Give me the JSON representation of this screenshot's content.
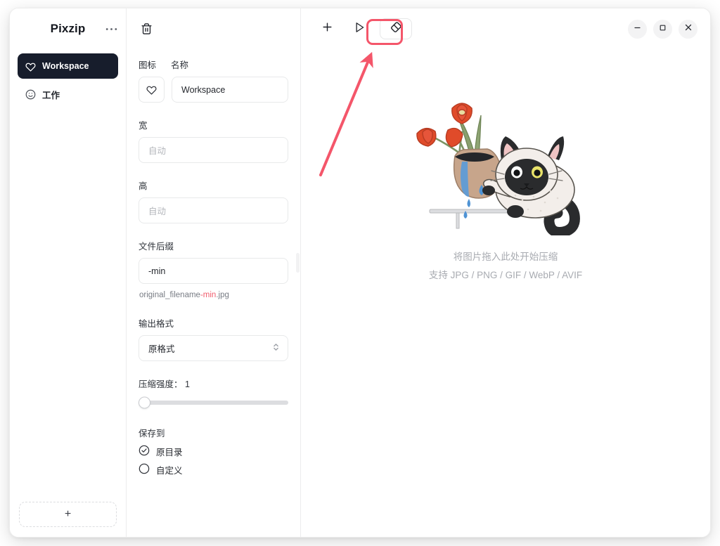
{
  "app": {
    "title": "Pixzip",
    "menu_icon": "ellipsis-icon",
    "add_workspace_label": "+"
  },
  "sidebar": {
    "items": [
      {
        "label": "Workspace",
        "icon": "heart-icon",
        "selected": true
      },
      {
        "label": "工作",
        "icon": "smiley-icon",
        "selected": false
      }
    ]
  },
  "settings": {
    "delete_icon": "trash-icon",
    "icon_label": "图标",
    "name_label": "名称",
    "name_value": "Workspace",
    "icon_value": "heart-icon",
    "width_label": "宽",
    "width_placeholder": "自动",
    "height_label": "高",
    "height_placeholder": "自动",
    "suffix_label": "文件后缀",
    "suffix_value": "-min",
    "suffix_hint_prefix": "original_filename",
    "suffix_hint_highlight": "-min",
    "suffix_hint_ext": ".jpg",
    "format_label": "输出格式",
    "format_value": "原格式",
    "format_options": [
      "原格式"
    ],
    "quality_label": "压缩强度： 1",
    "quality_value": 1,
    "quality_min": 1,
    "quality_max": 100,
    "save_to_label": "保存到",
    "save_options": [
      {
        "label": "原目录",
        "selected": true
      },
      {
        "label": "自定义",
        "selected": false
      }
    ]
  },
  "main": {
    "toolbar": {
      "add_icon": "plus-icon",
      "start_icon": "play-icon",
      "clear_icon": "eraser-icon"
    },
    "window_controls": {
      "minimize_icon": "minimize-icon",
      "maximize_icon": "maximize-icon",
      "close_icon": "close-icon"
    },
    "dropzone": {
      "illustration": "cat-pushing-vase-illustration",
      "line1": "将图片拖入此处开始压缩",
      "line2": "支持 JPG / PNG / GIF / WebP / AVIF"
    }
  },
  "annotation": {
    "highlight_target": "clear-button",
    "arrow": "pointer-arrow",
    "color": "#f4566a"
  }
}
